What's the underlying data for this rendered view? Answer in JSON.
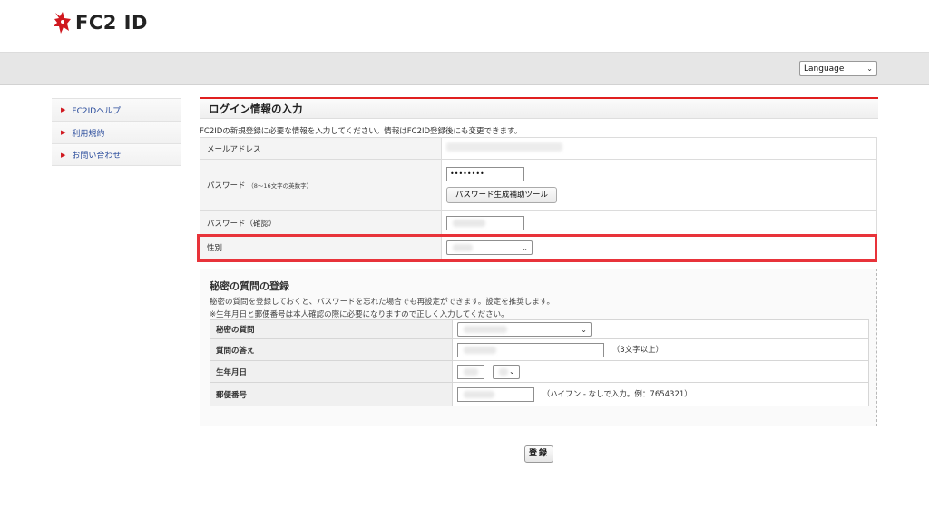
{
  "header": {
    "logo_text": "FC2 ID"
  },
  "language": {
    "selected": "Language"
  },
  "sidebar": {
    "items": [
      {
        "label": "FC2IDヘルプ"
      },
      {
        "label": "利用規約"
      },
      {
        "label": "お問い合わせ"
      }
    ]
  },
  "login_section": {
    "title": "ログイン情報の入力",
    "intro": "FC2IDの新規登録に必要な情報を入力してください。情報はFC2ID登録後にも変更できます。",
    "rows": {
      "email_label": "メールアドレス",
      "password_label": "パスワード",
      "password_hint": "（8～16文字の英数字）",
      "password_value": "••••••••",
      "password_tool_button": "パスワード生成補助ツール",
      "password_confirm_label": "パスワード（確認）",
      "gender_label": "性別"
    }
  },
  "secret_section": {
    "title": "秘密の質問の登録",
    "desc1": "秘密の質問を登録しておくと、パスワードを忘れた場合でも再設定ができます。設定を推奨します。",
    "desc2": "※生年月日と郵便番号は本人確認の際に必要になりますので正しく入力してください。",
    "rows": {
      "question_label": "秘密の質問",
      "answer_label": "質問の答え",
      "answer_note": "（3文字以上）",
      "birthdate_label": "生年月日",
      "postal_label": "郵便番号",
      "postal_note": "（ハイフン - なしで入力。例：7654321）"
    }
  },
  "submit": {
    "label": "登録"
  },
  "colors": {
    "accent": "#e02020",
    "highlight": "#e8333a",
    "link": "#2a4c9c"
  }
}
